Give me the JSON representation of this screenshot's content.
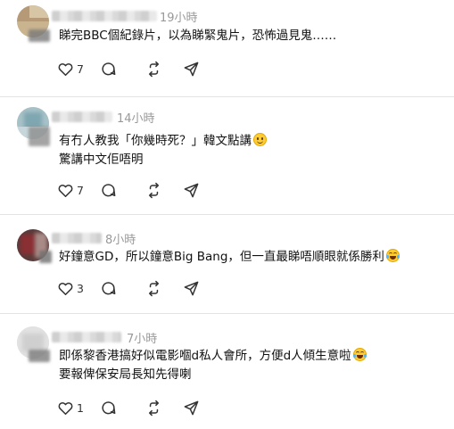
{
  "replies": [
    {
      "time": "19小時",
      "lines": [
        "睇完BBC個紀錄片，以為睇緊鬼片，恐怖過見鬼……"
      ],
      "emoji": "",
      "likes": "7"
    },
    {
      "time": "14小時",
      "lines": [
        "有冇人教我「你幾時死？」韓文點講",
        "驚講中文佢唔明"
      ],
      "emoji": "smiling-face",
      "likes": "7"
    },
    {
      "time": "8小時",
      "lines": [
        "好鐘意GD，所以鐘意Big Bang，但一直最睇唔順眼就係勝利"
      ],
      "emoji": "tears-of-joy-face",
      "likes": "3"
    },
    {
      "time": "7小時",
      "lines": [
        "即係黎香港搞好似電影嗰d私人會所，方便d人傾生意啦",
        "要報俾保安局長知先得喇"
      ],
      "emoji": "tears-of-joy-face",
      "likes": "1"
    }
  ],
  "icons": {
    "like": "heart-icon",
    "comment": "comment-bubble-icon",
    "repost": "repost-icon",
    "share": "send-icon"
  }
}
